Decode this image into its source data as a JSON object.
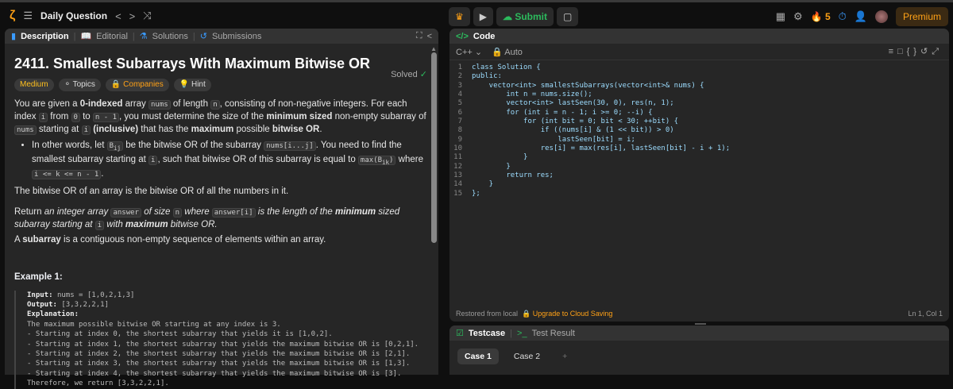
{
  "topbar": {
    "title": "Daily Question",
    "submit": "Submit",
    "streak": "5",
    "premium": "Premium"
  },
  "left": {
    "tabs": [
      "Description",
      "Editorial",
      "Solutions",
      "Submissions"
    ],
    "title": "2411. Smallest Subarrays With Maximum Bitwise OR",
    "solved": "Solved",
    "tags": [
      "Medium",
      "Topics",
      "Companies",
      "Hint"
    ],
    "example_title": "Example 1:",
    "example": {
      "input_label": "Input:",
      "input": "nums = [1,0,2,1,3]",
      "output_label": "Output:",
      "output": "[3,3,2,2,1]",
      "explanation_label": "Explanation:",
      "lines": [
        "The maximum possible bitwise OR starting at any index is 3.",
        "- Starting at index 0, the shortest subarray that yields it is [1,0,2].",
        "- Starting at index 1, the shortest subarray that yields the maximum bitwise OR is [0,2,1].",
        "- Starting at index 2, the shortest subarray that yields the maximum bitwise OR is [2,1].",
        "- Starting at index 3, the shortest subarray that yields the maximum bitwise OR is [1,3].",
        "- Starting at index 4, the shortest subarray that yields the maximum bitwise OR is [3].",
        "Therefore, we return [3,3,2,2,1]."
      ]
    }
  },
  "code": {
    "header": "Code",
    "lang": "C++",
    "mode": "Auto",
    "lines": [
      "class Solution {",
      "public:",
      "    vector<int> smallestSubarrays(vector<int>& nums) {",
      "        int n = nums.size();",
      "        vector<int> lastSeen(30, 0), res(n, 1);",
      "        for (int i = n - 1; i >= 0; --i) {",
      "            for (int bit = 0; bit < 30; ++bit) {",
      "                if ((nums[i] & (1 << bit)) > 0)",
      "                    lastSeen[bit] = i;",
      "                res[i] = max(res[i], lastSeen[bit] - i + 1);",
      "            }",
      "        }",
      "        return res;",
      "    }",
      "};"
    ],
    "status_left": "Restored from local",
    "upgrade": "Upgrade to Cloud Saving",
    "cursor": "Ln 1, Col 1"
  },
  "testcase": {
    "tab": "Testcase",
    "result_tab": "Test Result",
    "cases": [
      "Case 1",
      "Case 2"
    ],
    "add": "+"
  }
}
